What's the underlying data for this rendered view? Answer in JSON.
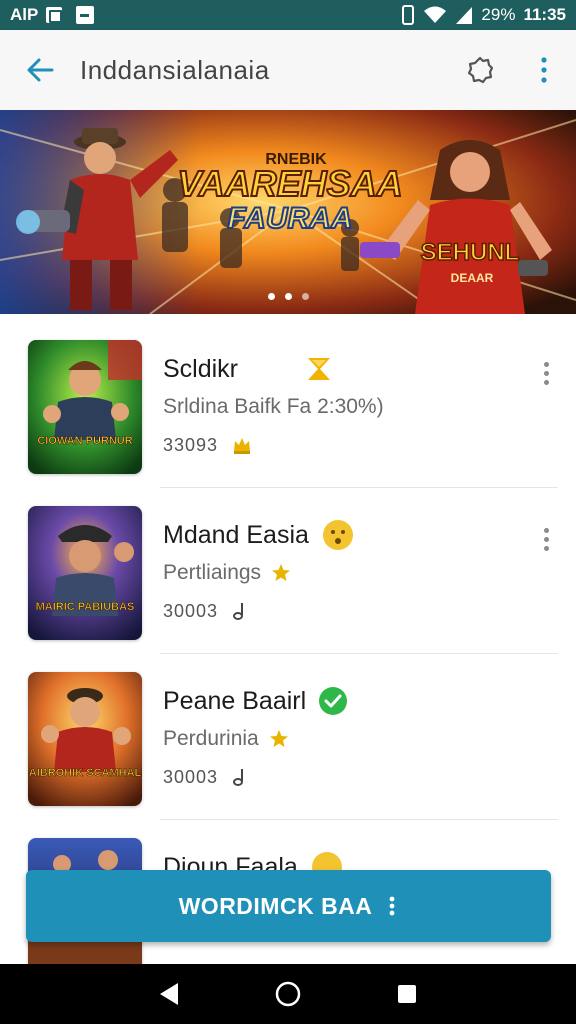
{
  "statusbar": {
    "left_text": "AlP",
    "battery_text": "29%",
    "time": "11:35"
  },
  "appbar": {
    "title": "Inddansialanaia"
  },
  "banner": {
    "headline_top": "RNEBIK",
    "headline_main": "VAAREHSAA",
    "headline_sub": "FAURAA",
    "side_title": "SEHUNL",
    "side_sub": "DEAAR"
  },
  "items": [
    {
      "name": "Scldikr",
      "subtitle": "Srldina Baifk  Fa 2:30%)",
      "meta": "33093",
      "thumb_text": "CIOWAN PURNUR",
      "badge": "hourglass"
    },
    {
      "name": "Mdand Easia",
      "subtitle": "Pertliaings",
      "meta": "30003",
      "thumb_text": "MAIRIC PABIUBAS",
      "badge": "emoji"
    },
    {
      "name": "Peane Baairl",
      "subtitle": "Perdurinia",
      "meta": "30003",
      "thumb_text": "CAIBROHIK SCAMHALK",
      "badge": "check"
    },
    {
      "name": "Dioun Faala",
      "subtitle": "",
      "meta": "",
      "thumb_text": "",
      "badge": "emoji"
    }
  ],
  "fab": {
    "label": "WORDIMCK BAA"
  },
  "colors": {
    "statusbar": "#1f5e5f",
    "accent": "#1f90b8",
    "check": "#2fb84a",
    "star": "#e8b400"
  }
}
